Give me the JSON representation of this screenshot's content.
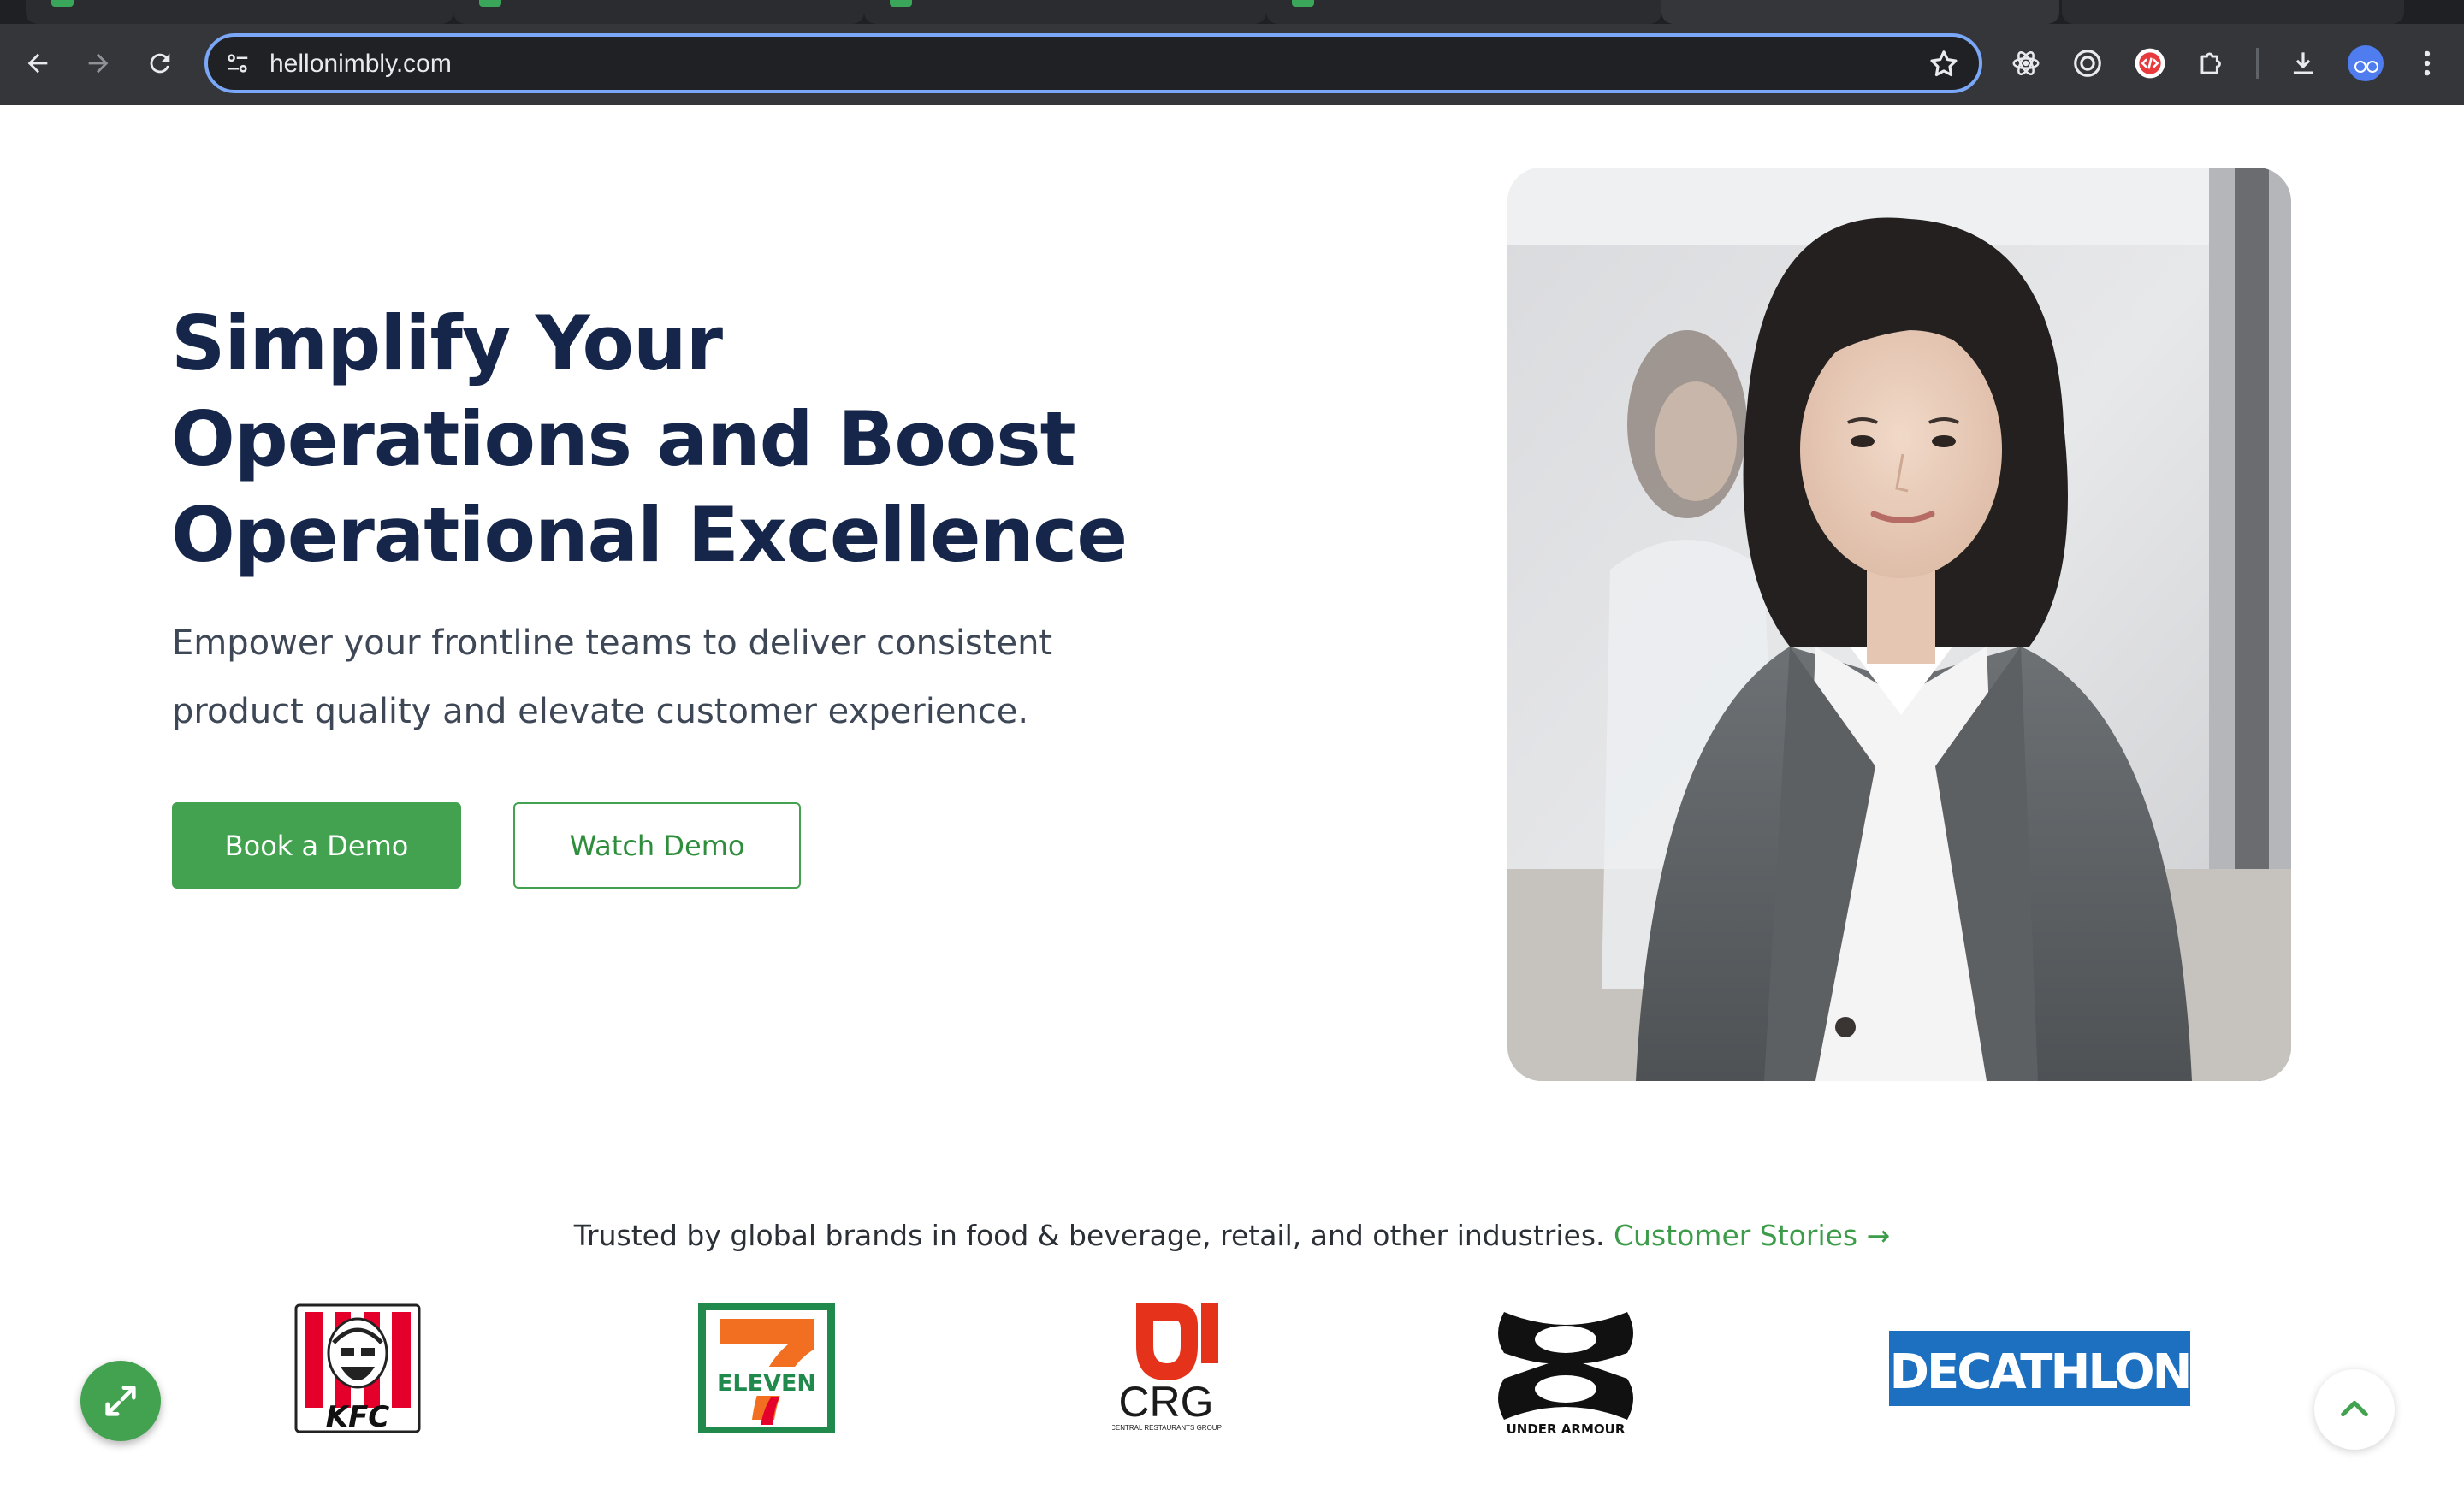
{
  "browser": {
    "url": "hellonimbly.com",
    "icons": {
      "back": "arrow-left-icon",
      "forward": "arrow-right-icon",
      "reload": "reload-icon",
      "site_info": "tune-icon",
      "bookmark": "star-icon",
      "extensions": [
        "react-devtools-icon",
        "target-icon",
        "code-icon",
        "puzzle-icon"
      ],
      "download": "download-icon",
      "menu": "kebab-menu-icon"
    }
  },
  "hero": {
    "title": "Simplify Your Operations and Boost Operational Excellence",
    "subtitle": "Empower your frontline teams to deliver consistent product quality and elevate customer experience.",
    "primary_cta": "Book a Demo",
    "secondary_cta": "Watch Demo"
  },
  "trusted": {
    "text": "Trusted by global brands in food & beverage, retail, and other industries.",
    "link": "Customer Stories →"
  },
  "logos": [
    "KFC",
    "7-Eleven",
    "CRG",
    "Under Armour",
    "Decathlon"
  ],
  "logo_text": {
    "kfc": "KFC",
    "seven_eleven": "ELEVEN",
    "crg": "CRG",
    "crg_tagline": "CENTRAL RESTAURANTS GROUP",
    "under_armour": "UNDER ARMOUR",
    "decathlon": "DECATHLON"
  },
  "colors": {
    "brand_green": "#43a24f",
    "heading_navy": "#15264a",
    "chrome_dark": "#35363a",
    "omnibox_focus": "#7aa7f7"
  }
}
